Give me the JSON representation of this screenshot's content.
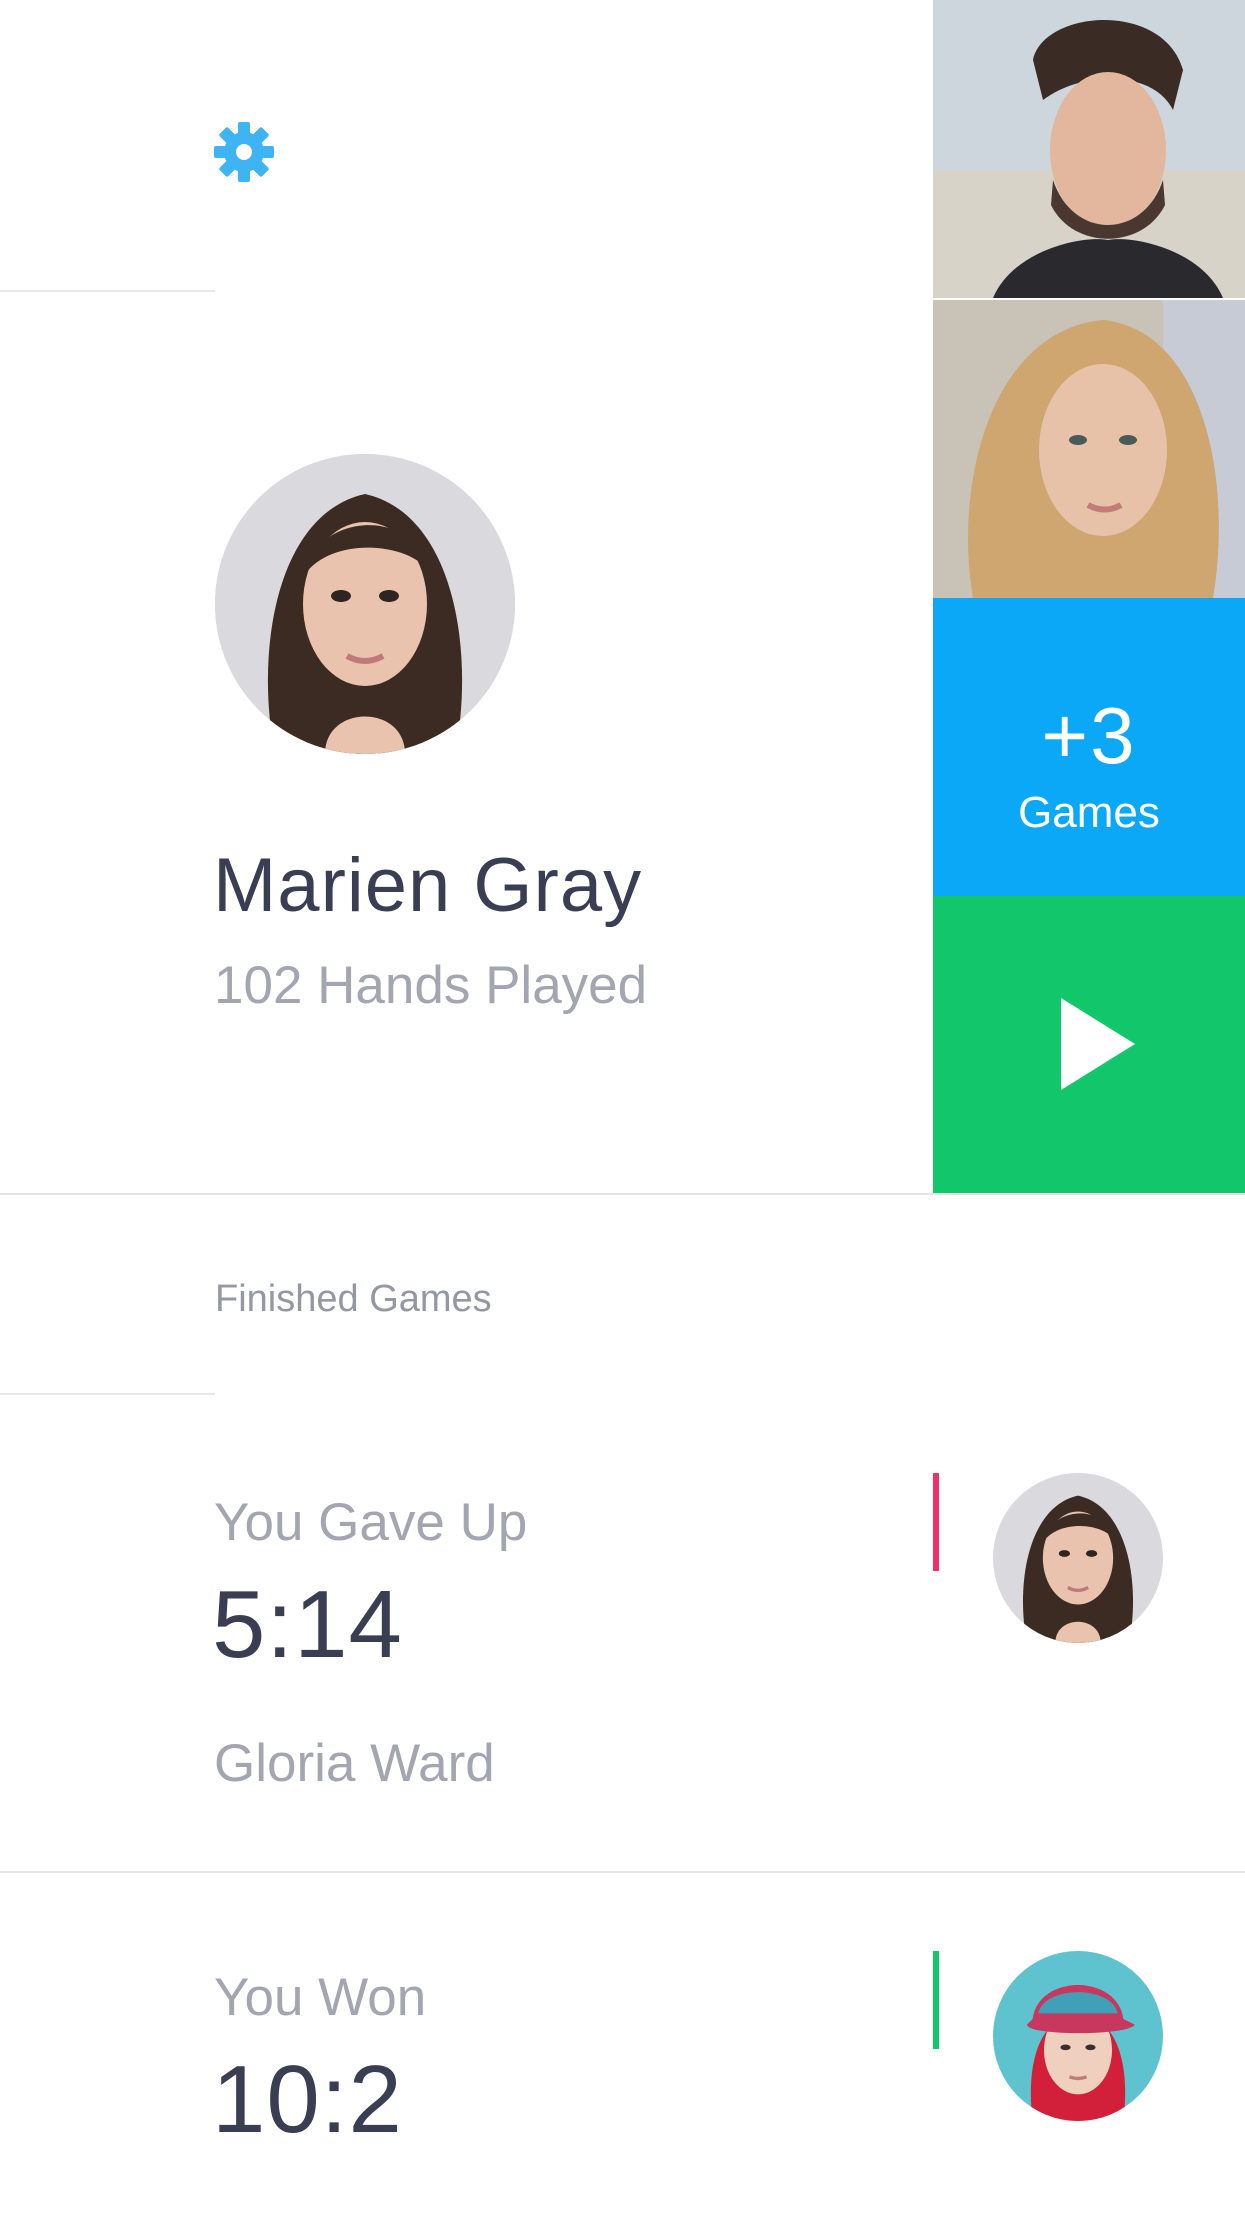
{
  "header": {
    "settings_icon": "gear-icon"
  },
  "profile": {
    "name": "Marien Gray",
    "hands_played": "102 Hands Played"
  },
  "side_tiles": {
    "more_games": {
      "count": "+3",
      "label": "Games"
    },
    "play_icon": "play-icon"
  },
  "finished": {
    "title": "Finished Games",
    "games": [
      {
        "result": "You Gave Up",
        "score": "5:14",
        "opponent": "Gloria Ward",
        "accent": "#f0306a"
      },
      {
        "result": "You Won",
        "score": "10:2",
        "opponent": "",
        "accent": "#12c76b"
      }
    ]
  },
  "colors": {
    "accent_blue": "#0ca8f8",
    "accent_green": "#12c76b",
    "accent_red": "#f0306a",
    "text_dark": "#3a3e52",
    "text_muted": "#a3a5b1",
    "gear": "#3fb4f5"
  }
}
